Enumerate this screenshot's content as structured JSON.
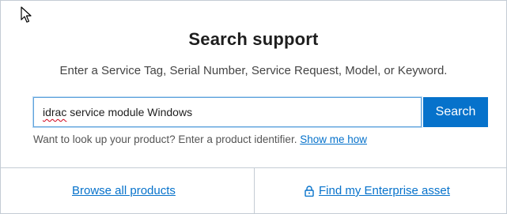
{
  "search_card": {
    "title": "Search support",
    "subtitle": "Enter a Service Tag, Serial Number, Service Request, Model, or Keyword.",
    "input": {
      "value_misspelled": "idrac",
      "value_rest": " service module Windows"
    },
    "search_button_label": "Search",
    "helper_text": "Want to look up your product? Enter a product identifier.",
    "helper_link": "Show me how"
  },
  "bottom_links": {
    "browse_label": "Browse all products",
    "enterprise_label": "Find my Enterprise asset"
  },
  "icons": {
    "cursor": "mouse-pointer-icon",
    "lock": "lock-icon"
  },
  "colors": {
    "accent": "#0672cb",
    "border": "#c4ccd4"
  }
}
